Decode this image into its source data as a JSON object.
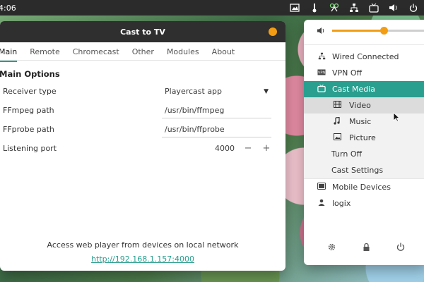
{
  "topbar": {
    "clock": "4:06"
  },
  "window": {
    "title": "Cast to TV",
    "tabs": [
      "Main",
      "Remote",
      "Chromecast",
      "Other",
      "Modules",
      "About"
    ],
    "section_heading": "Main Options",
    "options": [
      {
        "label": "Receiver type",
        "value": "Playercast app"
      },
      {
        "label": "FFmpeg path",
        "value": "/usr/bin/ffmpeg"
      },
      {
        "label": "FFprobe path",
        "value": "/usr/bin/ffprobe"
      },
      {
        "label": "Listening port",
        "value": "4000",
        "minus": "−",
        "plus": "+"
      }
    ],
    "footer_text": "Access web player from devices on local network",
    "footer_link": "http://192.168.1.157:4000"
  },
  "sysmenu": {
    "volume_level": 0.55,
    "items": {
      "wired": "Wired Connected",
      "vpn": "VPN Off",
      "cast_media": "Cast Media",
      "video": "Video",
      "music": "Music",
      "picture": "Picture",
      "turn_off": "Turn Off",
      "cast_settings": "Cast Settings",
      "mobile": "Mobile Devices",
      "user": "logix"
    }
  },
  "colors": {
    "accent": "#2a9e8f",
    "orange": "#f29d14"
  }
}
